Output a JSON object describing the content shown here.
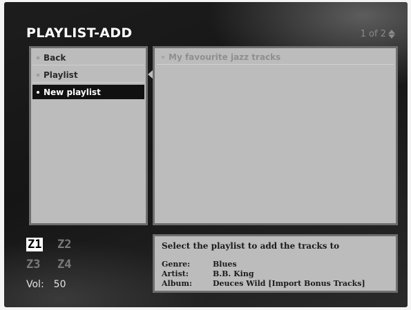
{
  "header": {
    "title": "PLAYLIST-ADD",
    "pager": "1 of 2"
  },
  "menu": {
    "items": [
      {
        "label": "Back"
      },
      {
        "label": "Playlist"
      },
      {
        "label": "New playlist"
      }
    ],
    "selected": "New playlist"
  },
  "playlists": {
    "items": [
      {
        "label": "My favourite jazz tracks"
      }
    ]
  },
  "info": {
    "heading": "Select the playlist to add the tracks to",
    "genre_label": "Genre:",
    "genre": "Blues",
    "artist_label": "Artist:",
    "artist": "B.B. King",
    "album_label": "Album:",
    "album": "Deuces Wild [Import Bonus Tracks]"
  },
  "zones": {
    "z1": "Z1",
    "z2": "Z2",
    "z3": "Z3",
    "z4": "Z4",
    "active": "Z1"
  },
  "volume": {
    "label": "Vol:",
    "value": "50"
  },
  "colors": {
    "panel": "#bcbcbc",
    "selected_bg": "#111111",
    "background": "#1d1d1d"
  }
}
